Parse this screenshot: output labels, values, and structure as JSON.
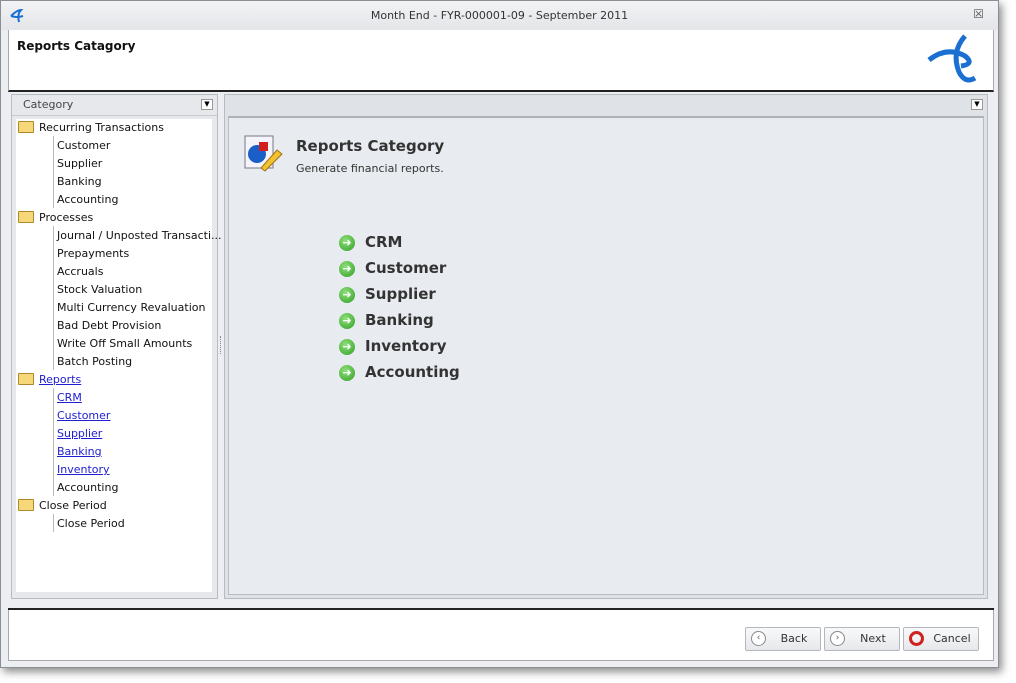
{
  "window": {
    "title": "Month End - FYR-000001-09 - September 2011"
  },
  "header": {
    "title": "Reports Catagory"
  },
  "category_panel": {
    "title": "Category",
    "tree": [
      {
        "label": "Recurring Transactions",
        "children": [
          {
            "label": "Customer"
          },
          {
            "label": "Supplier"
          },
          {
            "label": "Banking"
          },
          {
            "label": "Accounting"
          }
        ]
      },
      {
        "label": "Processes",
        "children": [
          {
            "label": "Journal / Unposted Transacti..."
          },
          {
            "label": "Prepayments"
          },
          {
            "label": "Accruals"
          },
          {
            "label": "Stock Valuation"
          },
          {
            "label": "Multi Currency Revaluation"
          },
          {
            "label": "Bad Debt Provision"
          },
          {
            "label": "Write Off Small Amounts"
          },
          {
            "label": "Batch Posting"
          }
        ]
      },
      {
        "label": "Reports",
        "link": true,
        "children": [
          {
            "label": "CRM",
            "link": true
          },
          {
            "label": "Customer",
            "link": true
          },
          {
            "label": "Supplier",
            "link": true
          },
          {
            "label": "Banking",
            "link": true
          },
          {
            "label": "Inventory",
            "link": true
          },
          {
            "label": "Accounting"
          }
        ]
      },
      {
        "label": "Close Period",
        "children": [
          {
            "label": "Close Period"
          }
        ]
      }
    ]
  },
  "content": {
    "title": "Reports Category",
    "subtitle": "Generate financial reports.",
    "items": [
      "CRM",
      "Customer",
      "Supplier",
      "Banking",
      "Inventory",
      "Accounting"
    ]
  },
  "footer": {
    "back": "Back",
    "next": "Next",
    "cancel": "Cancel"
  }
}
